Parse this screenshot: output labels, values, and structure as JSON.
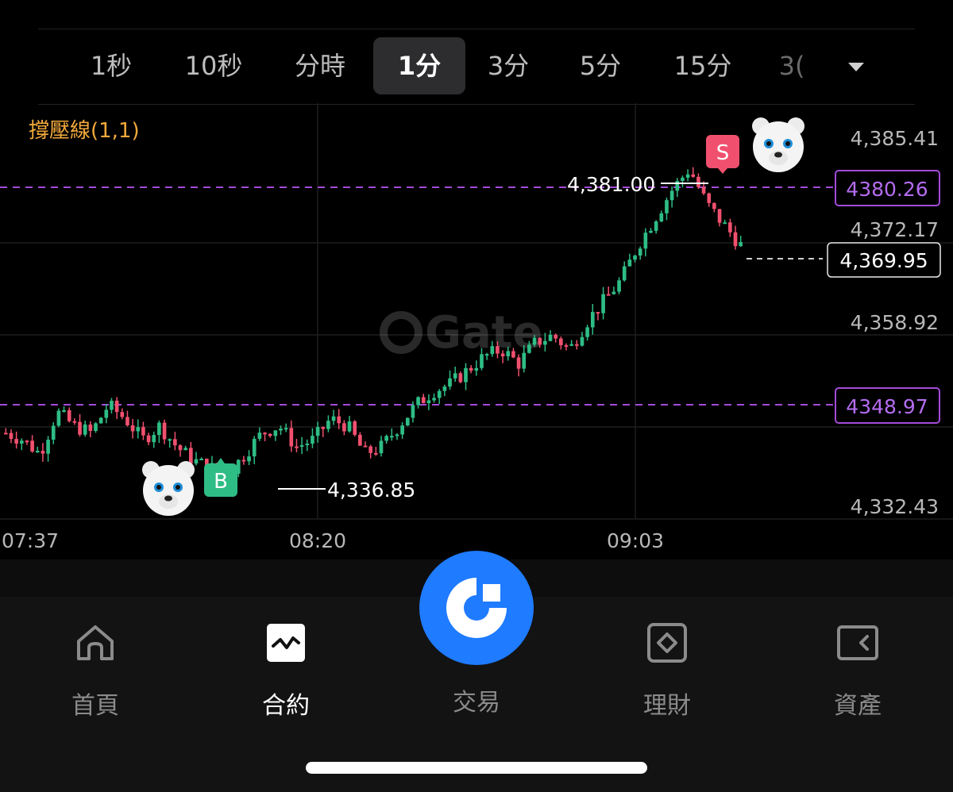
{
  "timeframes": {
    "items": [
      {
        "label": "1秒",
        "active": false
      },
      {
        "label": "10秒",
        "active": false
      },
      {
        "label": "分時",
        "active": false
      },
      {
        "label": "1分",
        "active": true
      },
      {
        "label": "3分",
        "active": false
      },
      {
        "label": "5分",
        "active": false
      },
      {
        "label": "15分",
        "active": false
      },
      {
        "label": "3(",
        "active": false
      }
    ],
    "more_icon": "chevron-down-icon"
  },
  "chart": {
    "indicator_label": "撐壓線(1,1)",
    "watermark": "Gate",
    "price_axis": [
      "4,385.41",
      "4,372.17",
      "4,358.92",
      "4,332.43"
    ],
    "time_axis": [
      "07:37",
      "08:20",
      "09:03"
    ],
    "resistance_label": "4380.26",
    "support_label": "4348.97",
    "current_price": "4,369.95",
    "high_label": "4,381.00",
    "low_label": "4,336.85",
    "buy_marker": "B",
    "sell_marker": "S",
    "colors": {
      "up": "#2ebd85",
      "down": "#f0506e",
      "level": "#a34bd9",
      "indicator": "#f2a93b"
    }
  },
  "chart_data": {
    "type": "candlestick",
    "x": [
      "07:37",
      "08:20",
      "09:03"
    ],
    "ylim": [
      4332.43,
      4385.41
    ],
    "close_path": [
      4343,
      4342,
      4340,
      4346,
      4344,
      4343,
      4347,
      4345,
      4342,
      4344,
      4341,
      4339,
      4338,
      4337,
      4340,
      4343,
      4344,
      4341,
      4342,
      4345,
      4344,
      4340,
      4341,
      4344,
      4347,
      4349,
      4350,
      4352,
      4354,
      4355,
      4353,
      4356,
      4357,
      4355,
      4359,
      4362,
      4365,
      4370,
      4374,
      4378,
      4381,
      4376,
      4373,
      4370
    ],
    "lines": [
      4380.26,
      4348.97
    ]
  },
  "tabbar": {
    "items": [
      {
        "label": "首頁",
        "icon": "home-icon",
        "active": false
      },
      {
        "label": "合約",
        "icon": "contract-chart-icon",
        "active": true
      },
      {
        "label": "交易",
        "icon": "gate-logo-icon",
        "active": false
      },
      {
        "label": "理財",
        "icon": "finance-diamond-icon",
        "active": false
      },
      {
        "label": "資產",
        "icon": "wallet-icon",
        "active": false
      }
    ]
  }
}
